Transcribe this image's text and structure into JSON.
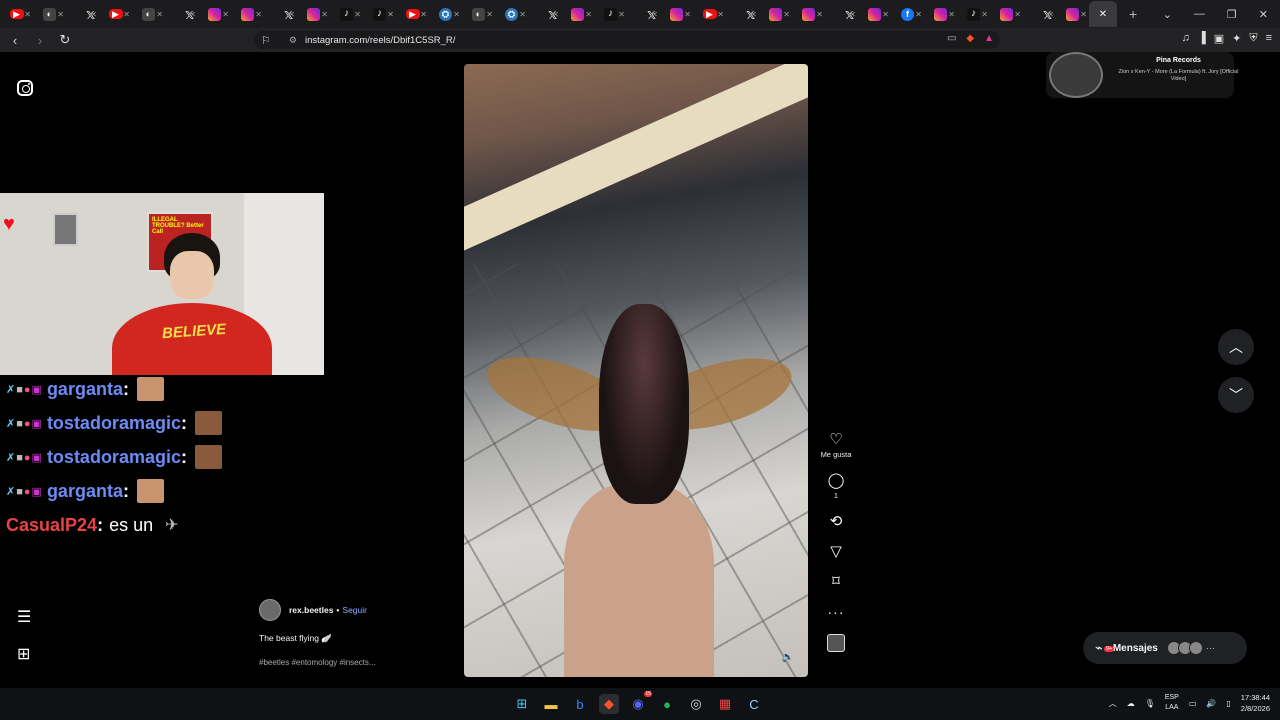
{
  "browser": {
    "tabs": [
      {
        "type": "yt"
      },
      {
        "type": "gen",
        "label": "c"
      },
      {
        "type": "x"
      },
      {
        "type": "yt"
      },
      {
        "type": "gen"
      },
      {
        "type": "x"
      },
      {
        "type": "ig"
      },
      {
        "type": "ig"
      },
      {
        "type": "x"
      },
      {
        "type": "ig"
      },
      {
        "type": "tt"
      },
      {
        "type": "tt"
      },
      {
        "type": "yt"
      },
      {
        "type": "st"
      },
      {
        "type": "gen"
      },
      {
        "type": "st"
      },
      {
        "type": "x"
      },
      {
        "type": "ig"
      },
      {
        "type": "tt"
      },
      {
        "type": "x"
      },
      {
        "type": "ig"
      },
      {
        "type": "yt"
      },
      {
        "type": "x"
      },
      {
        "type": "ig"
      },
      {
        "type": "ig"
      },
      {
        "type": "x"
      },
      {
        "type": "ig"
      },
      {
        "type": "fb"
      },
      {
        "type": "ig"
      },
      {
        "type": "tt"
      },
      {
        "type": "ig"
      },
      {
        "type": "x"
      },
      {
        "type": "ig"
      }
    ],
    "url": "instagram.com/reels/Dbif1C5SR_R/"
  },
  "chat": [
    {
      "user": "garganta",
      "sep": ":",
      "msg": "",
      "emote": true,
      "user_color": "blue"
    },
    {
      "user": "tostadoramagic",
      "sep": ":",
      "msg": "",
      "emote": true,
      "user_color": "blue"
    },
    {
      "user": "tostadoramagic",
      "sep": ":",
      "msg": "",
      "emote": true,
      "user_color": "blue"
    },
    {
      "user": "garganta",
      "sep": ":",
      "msg": "",
      "emote": true,
      "user_color": "blue"
    },
    {
      "user": "CasualP24",
      "sep": ":",
      "msg": "es un",
      "emote": false,
      "user_color": "red"
    }
  ],
  "webcam": {
    "poster_text": "ILLEGAL TROUBLE? Better Call",
    "shirt_text": "BELIEVE"
  },
  "reel": {
    "author": "rex.beetles",
    "separator": "•",
    "follow_label": "Seguir",
    "caption": "The beast flying 🪽",
    "hashtags": "#beetles #entomology #insects...",
    "like_label": "Me gusta",
    "comment_count": "1"
  },
  "mini_player": {
    "channel": "Pina Records",
    "title": "Zion x Ken-Y - More (La Formula) ft. Jory [Official Video]"
  },
  "messages": {
    "label": "Mensajes",
    "badge": "9+"
  },
  "taskbar": {
    "lang_top": "ESP",
    "lang_bottom": "LAA",
    "time": "17:38:44",
    "date": "2/8/2026",
    "discord_badge": "15"
  }
}
